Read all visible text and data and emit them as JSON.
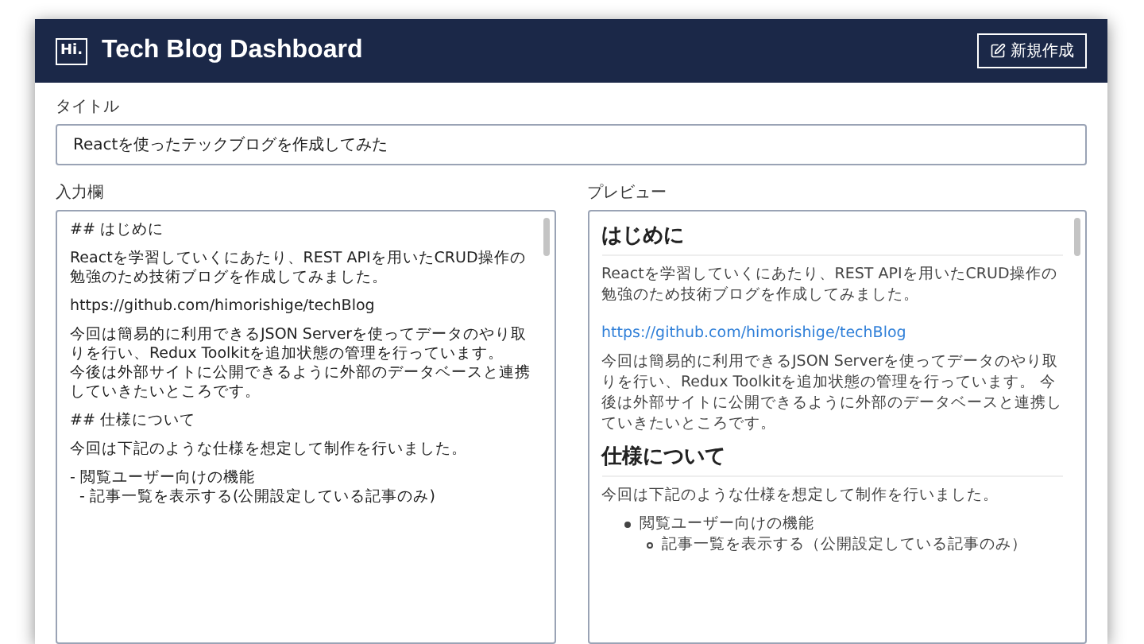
{
  "header": {
    "logo": "Hi.",
    "title": "Tech Blog Dashboard",
    "new_button": "新規作成"
  },
  "title_field": {
    "label": "タイトル",
    "value": "Reactを使ったテックブログを作成してみた"
  },
  "editor": {
    "label": "入力欄",
    "paragraphs": [
      [
        "## はじめに"
      ],
      [
        "Reactを学習していくにあたり、REST APIを用いたCRUD操作の勉強のため技術ブログを作成してみました。"
      ],
      [
        "https://github.com/himorishige/techBlog"
      ],
      [
        "今回は簡易的に利用できるJSON Serverを使ってデータのやり取りを行い、Redux Toolkitを追加状態の管理を行っています。",
        "今後は外部サイトに公開できるように外部のデータベースと連携していきたいところです。"
      ],
      [
        "## 仕様について"
      ],
      [
        "今回は下記のような仕様を想定して制作を行いました。"
      ],
      [
        "- 閲覧ユーザー向けの機能",
        "  - 記事一覧を表示する(公開設定している記事のみ)"
      ]
    ]
  },
  "preview": {
    "label": "プレビュー",
    "blocks": [
      {
        "kind": "heading",
        "text": "はじめに"
      },
      {
        "kind": "paragraph",
        "text": "Reactを学習していくにあたり、REST APIを用いたCRUD操作の勉強のため技術ブログを作成してみました。"
      },
      {
        "kind": "link",
        "text": "https://github.com/himorishige/techBlog"
      },
      {
        "kind": "paragraph",
        "text": "今回は簡易的に利用できるJSON Serverを使ってデータのやり取りを行い、Redux Toolkitを追加状態の管理を行っています。 今後は外部サイトに公開できるように外部のデータベースと連携していきたいところです。"
      },
      {
        "kind": "heading",
        "text": "仕様について"
      },
      {
        "kind": "paragraph",
        "text": "今回は下記のような仕様を想定して制作を行いました。"
      },
      {
        "kind": "list",
        "items": [
          {
            "text": "閲覧ユーザー向けの機能",
            "children": [
              {
                "text": "記事一覧を表示する（公開設定している記事のみ）"
              }
            ]
          }
        ]
      }
    ]
  }
}
